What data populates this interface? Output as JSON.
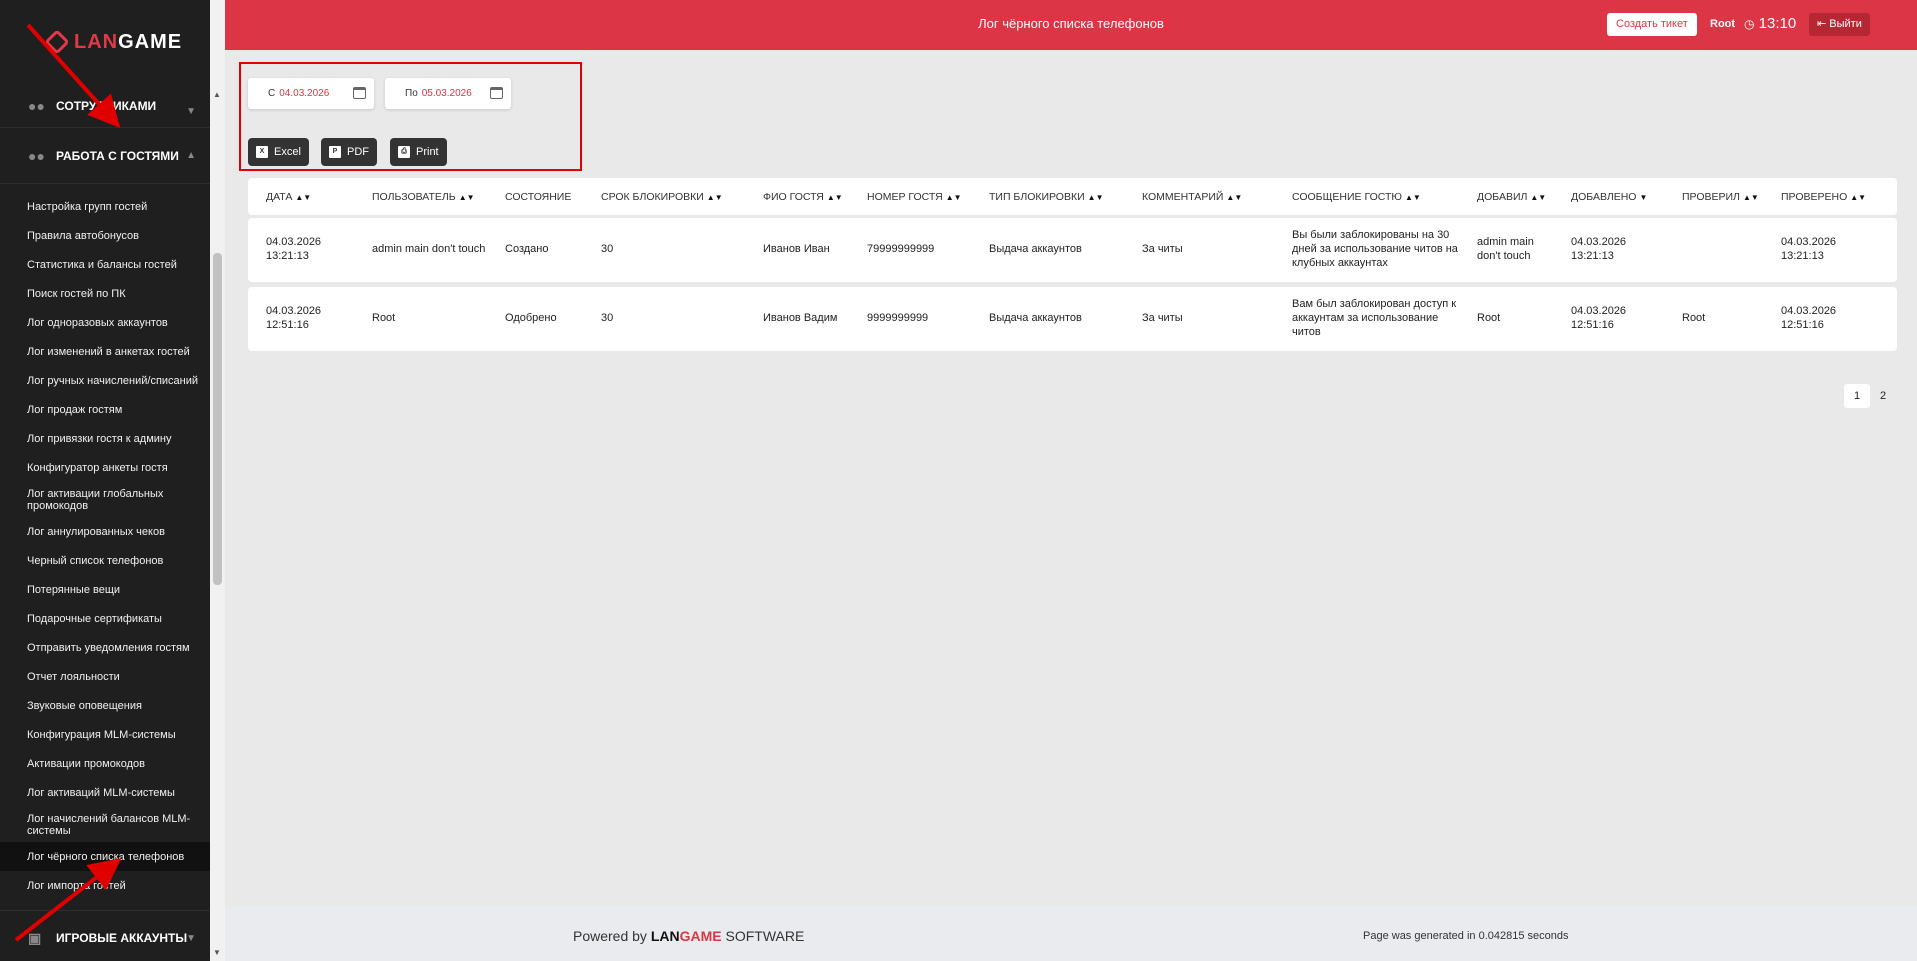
{
  "brand": {
    "logo_text": "LANGAME"
  },
  "sidebar": {
    "section_staff": "СОТРУДНИКАМИ",
    "section_guests": "РАБОТА С ГОСТЯМИ",
    "section_game_accounts": "ИГРОВЫЕ АККАУНТЫ",
    "items": [
      "Настройка групп гостей",
      "Правила автобонусов",
      "Статистика и балансы гостей",
      "Поиск гостей по ПК",
      "Лог одноразовых аккаунтов",
      "Лог изменений в анкетах гостей",
      "Лог ручных начислений/списаний",
      "Лог продаж гостям",
      "Лог привязки гостя к админу",
      "Конфигуратор анкеты гостя",
      "Лог активации глобальных промокодов",
      "Лог аннулированных чеков",
      "Черный список телефонов",
      "Потерянные вещи",
      "Подарочные сертификаты",
      "Отправить уведомления гостям",
      "Отчет лояльности",
      "Звуковые оповещения",
      "Конфигурация MLM-системы",
      "Активации промокодов",
      "Лог активаций MLM-системы",
      "Лог начислений балансов MLM-системы",
      "Лог чёрного списка телефонов",
      "Лог импорта гостей"
    ]
  },
  "header": {
    "title": "Лог чёрного списка телефонов",
    "create_ticket": "Создать тикет",
    "user": "Root",
    "time": "13:10",
    "logout": "Выйти"
  },
  "filters": {
    "from_label": "С",
    "from_value": "04.03.2026",
    "to_label": "По",
    "to_value": "05.03.2026"
  },
  "export": {
    "excel": "Excel",
    "pdf": "PDF",
    "print": "Print"
  },
  "table": {
    "columns": [
      "ДАТА",
      "ПОЛЬЗОВАТЕЛЬ",
      "СОСТОЯНИЕ",
      "СРОК БЛОКИРОВКИ",
      "ФИО ГОСТЯ",
      "НОМЕР ГОСТЯ",
      "ТИП БЛОКИРОВКИ",
      "КОММЕНТАРИЙ",
      "СООБЩЕНИЕ ГОСТЮ",
      "ДОБАВИЛ",
      "ДОБАВЛЕНО",
      "ПРОВЕРИЛ",
      "ПРОВЕРЕНО"
    ],
    "rows": [
      {
        "date": "04.03.2026 13:21:13",
        "user": "admin main don't touch",
        "state": "Создано",
        "term": "30",
        "name": "Иванов Иван",
        "phone": "79999999999",
        "type": "Выдача аккаунтов",
        "comment": "За читы",
        "message": "Вы были заблокированы на 30 дней за использование читов на клубных аккаунтах",
        "added_by": "admin main don't touch",
        "added": "04.03.2026 13:21:13",
        "checked_by": "",
        "checked": "04.03.2026 13:21:13"
      },
      {
        "date": "04.03.2026 12:51:16",
        "user": "Root",
        "state": "Одобрено",
        "term": "30",
        "name": "Иванов Вадим",
        "phone": "9999999999",
        "type": "Выдача аккаунтов",
        "comment": "За читы",
        "message": "Вам был заблокирован доступ к аккаунтам за использование читов",
        "added_by": "Root",
        "added": "04.03.2026 12:51:16",
        "checked_by": "Root",
        "checked": "04.03.2026 12:51:16"
      }
    ]
  },
  "pagination": {
    "pages": [
      "1",
      "2"
    ],
    "current": "1"
  },
  "footer": {
    "powered_prefix": "Powered by",
    "powered_brand": "LANGAME",
    "powered_suffix": "SOFTWARE",
    "generated": "Page was generated in 0.042815 seconds"
  },
  "colors": {
    "accent": "#dc3545",
    "sidebar": "#1f1f1f",
    "annotation": "#e00000"
  }
}
